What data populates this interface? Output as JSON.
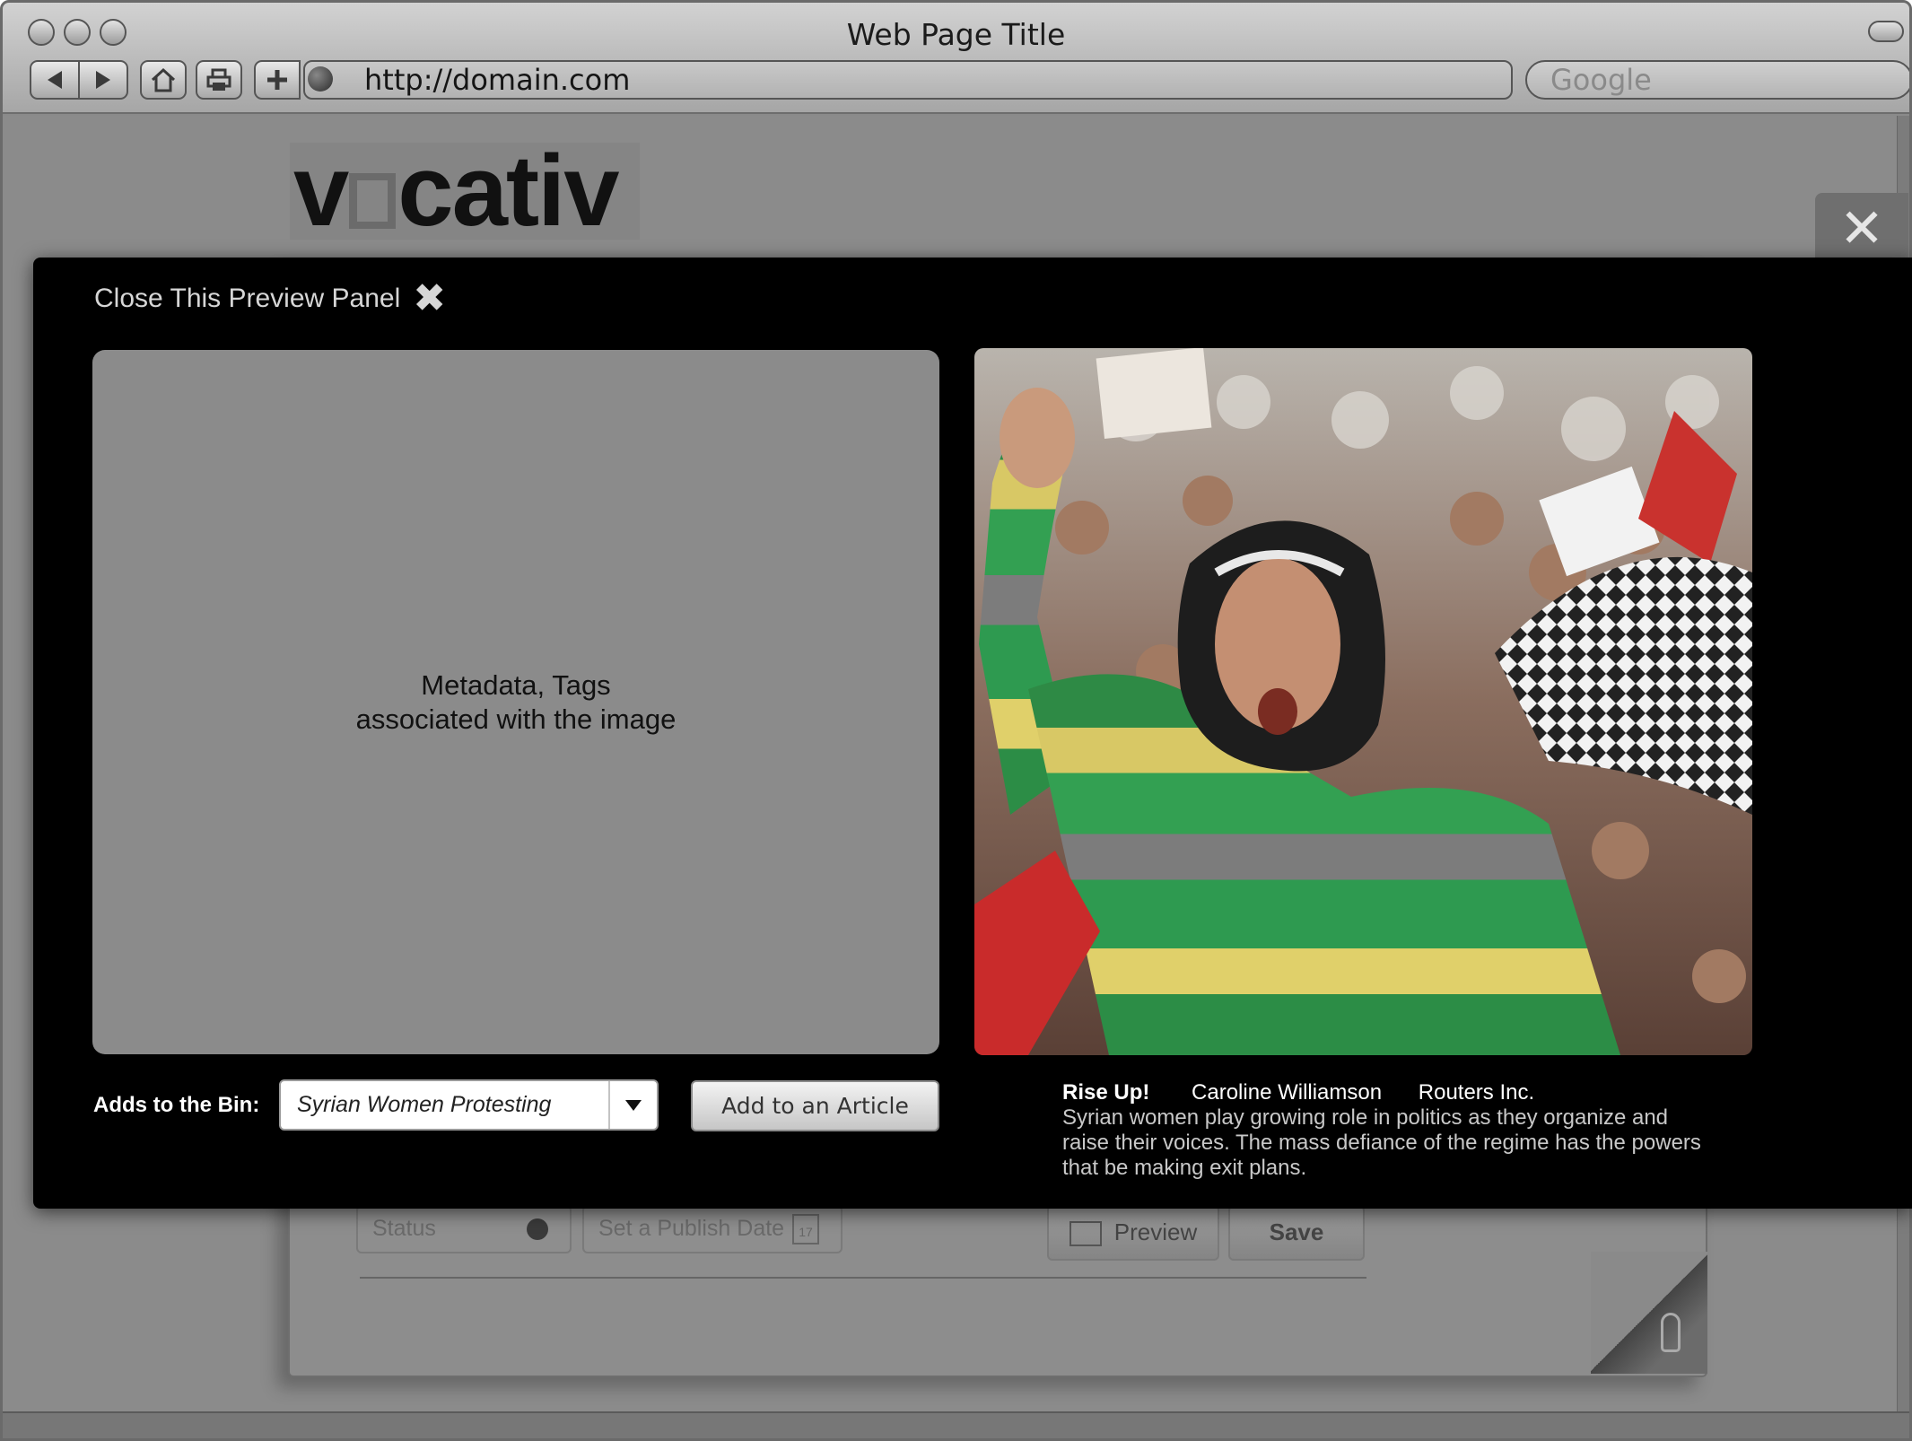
{
  "browser": {
    "window_title": "Web Page Title",
    "url": "http://domain.com",
    "search_placeholder": "Google"
  },
  "page": {
    "logo_left": "v",
    "logo_right": "cativ",
    "background_form": {
      "status_label": "Status",
      "publish_date_label": "Set a Publish Date",
      "calendar_day": "17",
      "preview_label": "Preview",
      "save_label": "Save"
    }
  },
  "preview_panel": {
    "close_label": "Close This Preview Panel",
    "metadata_line1": "Metadata, Tags",
    "metadata_line2": "associated with the image",
    "bin_label": "Adds to  the Bin:",
    "bin_value": "Syrian Women Protesting",
    "add_article_label": "Add to an Article",
    "caption": {
      "title": "Rise Up!",
      "author": "Caroline Williamson",
      "source": "Routers Inc.",
      "body": "Syrian women play growing role in politics as they organize and raise their voices. The mass defiance of the regime has the powers that be making exit plans."
    }
  }
}
